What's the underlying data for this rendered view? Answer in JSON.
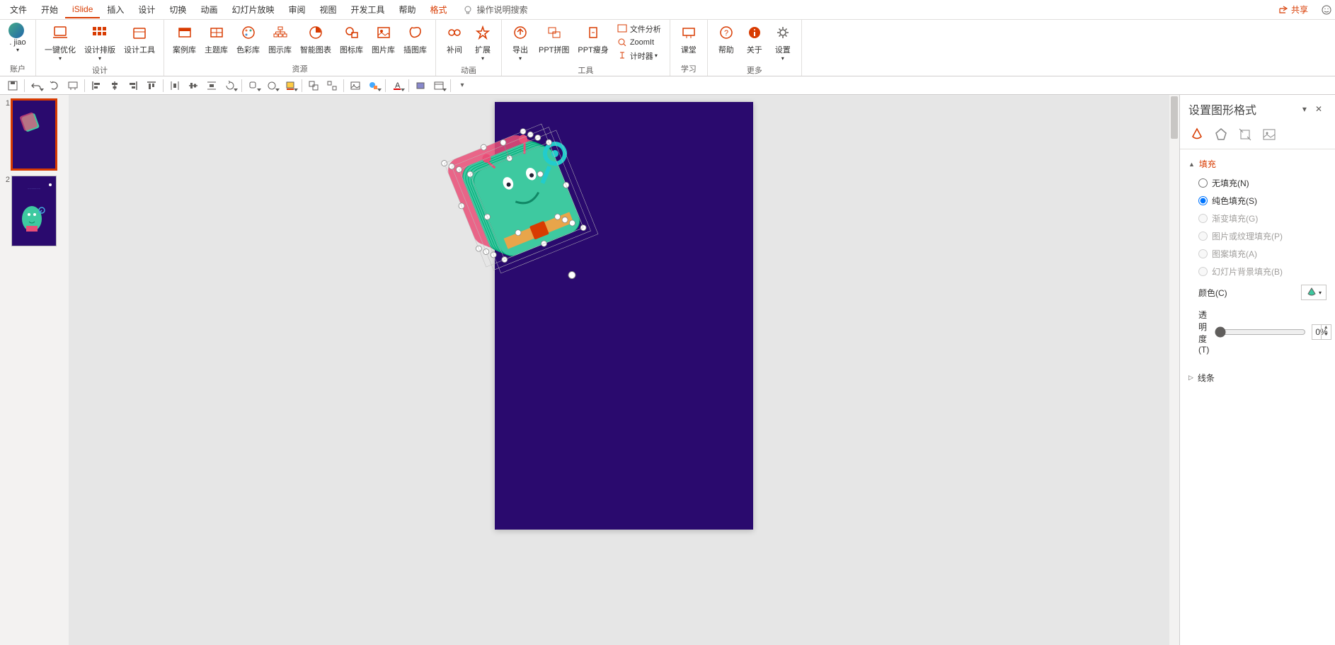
{
  "menu": {
    "file": "文件",
    "home": "开始",
    "islide": "iSlide",
    "insert": "插入",
    "design": "设计",
    "transitions": "切换",
    "animations": "动画",
    "slideshow": "幻灯片放映",
    "review": "审阅",
    "view": "视图",
    "dev": "开发工具",
    "help": "帮助",
    "format": "格式",
    "search": "操作说明搜索",
    "share": "共享"
  },
  "ribbon": {
    "account": {
      "user": ". jiao",
      "group": "账户"
    },
    "design_grp": {
      "optimize": "一键优化",
      "layout": "设计排版",
      "tools": "设计工具",
      "group": "设计"
    },
    "resource": {
      "case": "案例库",
      "theme": "主题库",
      "color": "色彩库",
      "diagram": "图示库",
      "smart": "智能图表",
      "icon": "图标库",
      "pic": "图片库",
      "illus": "插图库",
      "group": "资源"
    },
    "anim": {
      "tween": "补间",
      "extend": "扩展",
      "group": "动画"
    },
    "tool": {
      "export": "导出",
      "pptjoin": "PPT拼图",
      "pptslim": "PPT瘦身",
      "filean": "文件分析",
      "zoomit": "ZoomIt",
      "timer": "计时器",
      "group": "工具"
    },
    "learn": {
      "class": "课堂",
      "group": "学习"
    },
    "more": {
      "help": "帮助",
      "about": "关于",
      "settings": "设置",
      "group": "更多"
    }
  },
  "thumbs": {
    "n1": "1",
    "n2": "2"
  },
  "formatPane": {
    "title": "设置图形格式",
    "fill": "填充",
    "noFill": "无填充(N)",
    "solidFill": "纯色填充(S)",
    "gradFill": "渐变填充(G)",
    "picFill": "图片或纹理填充(P)",
    "pattFill": "图案填充(A)",
    "bgFill": "幻灯片背景填充(B)",
    "color": "颜色(C)",
    "transparency": "透明度(T)",
    "transVal": "0%",
    "line": "线条"
  }
}
